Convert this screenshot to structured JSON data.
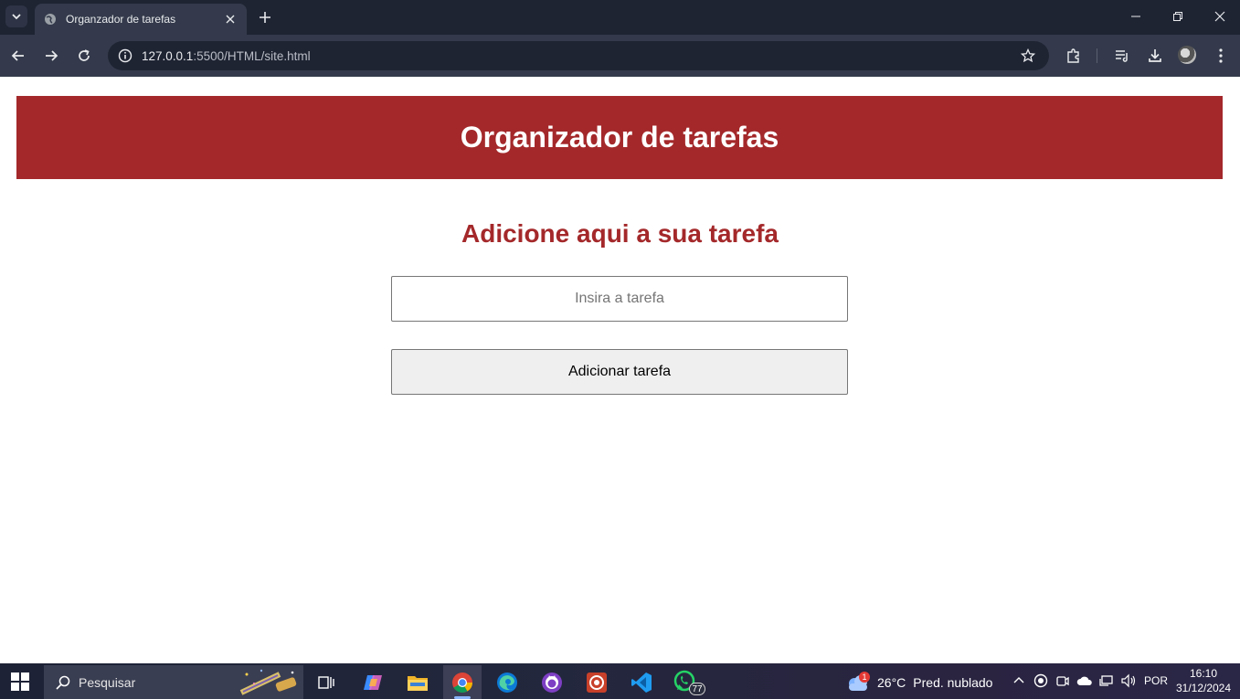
{
  "browser": {
    "tab_title": "Organzador de tarefas",
    "url_host": "127.0.0.1",
    "url_path": ":5500/HTML/site.html"
  },
  "page": {
    "header_title": "Organizador de tarefas",
    "subtitle": "Adicione aqui a sua tarefa",
    "input_placeholder": "Insira a tarefa",
    "input_value": "",
    "add_button_label": "Adicionar tarefa"
  },
  "taskbar": {
    "search_text": "Pesquisar",
    "whatsapp_badge": "77",
    "weather_badge": "1",
    "temperature": "26°C",
    "condition": "Pred. nublado",
    "language": "POR",
    "time": "16:10",
    "date": "31/12/2024"
  },
  "colors": {
    "header_bg": "#a4282a",
    "subtitle": "#a4282a",
    "chrome_dark": "#1f2433",
    "chrome_toolbar": "#343a4b"
  }
}
